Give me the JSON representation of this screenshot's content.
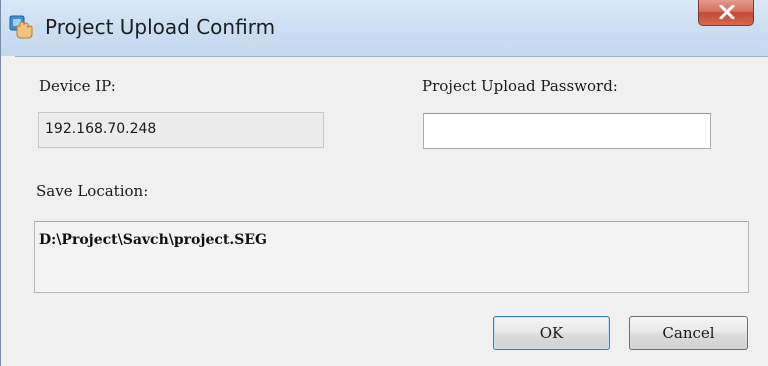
{
  "window": {
    "title": "Project Upload Confirm",
    "icon": "hand-with-key-icon",
    "close_icon": "close-x-icon"
  },
  "form": {
    "device_ip_label": "Device IP:",
    "device_ip_value": "192.168.70.248",
    "password_label": "Project Upload Password:",
    "password_value": "",
    "save_location_label": "Save Location:",
    "save_location_value": "D:\\Project\\Savch\\project.SEG"
  },
  "buttons": {
    "ok_label": "OK",
    "cancel_label": "Cancel"
  },
  "colors": {
    "titlebar": "#cddff3",
    "close_button": "#d5705c",
    "dialog_background": "#f0f0f0",
    "default_button_border": "#3c7fb1"
  }
}
